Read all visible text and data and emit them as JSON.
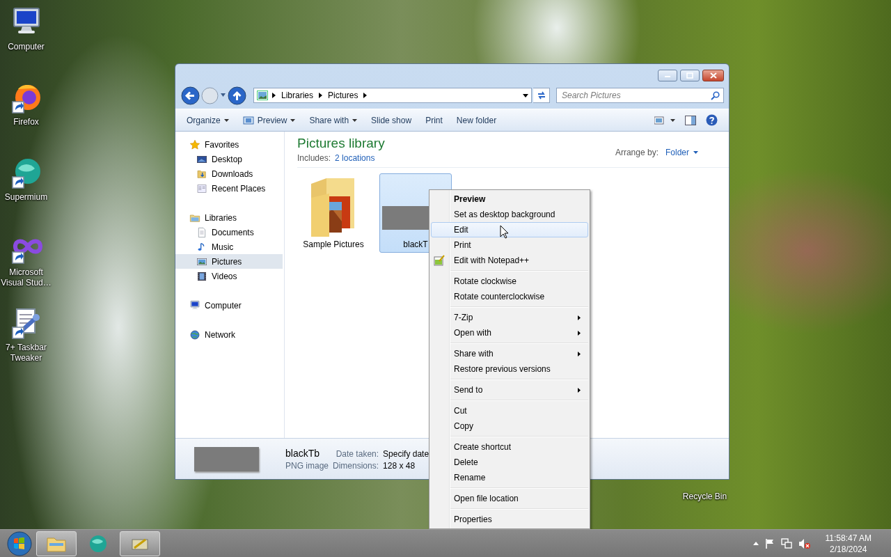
{
  "desktop_icons": [
    {
      "label": "Computer",
      "kind": "computer"
    },
    {
      "label": "Firefox",
      "kind": "firefox"
    },
    {
      "label": "Supermium",
      "kind": "supermium"
    },
    {
      "label": "Microsoft Visual Stud…",
      "kind": "infinity"
    },
    {
      "label": "7+ Taskbar Tweaker",
      "kind": "tweaker"
    }
  ],
  "recycle_bin": {
    "label": "Recycle Bin"
  },
  "window": {
    "address": {
      "path": [
        "Libraries",
        "Pictures"
      ]
    },
    "search": {
      "placeholder": "Search Pictures"
    },
    "toolbar": [
      {
        "label": "Organize",
        "kind": "menu"
      },
      {
        "label": "Preview",
        "kind": "iconmenu"
      },
      {
        "label": "Share with",
        "kind": "menu"
      },
      {
        "label": "Slide show",
        "kind": "plain"
      },
      {
        "label": "Print",
        "kind": "plain"
      },
      {
        "label": "New folder",
        "kind": "plain"
      }
    ],
    "sidebar": [
      {
        "label": "Favorites",
        "kind": "star",
        "selected": false,
        "children": [
          {
            "label": "Desktop",
            "kind": "desktop",
            "selected": false
          },
          {
            "label": "Downloads",
            "kind": "downloads",
            "selected": false
          },
          {
            "label": "Recent Places",
            "kind": "recent",
            "selected": false
          }
        ]
      },
      {
        "label": "Libraries",
        "kind": "library",
        "selected": false,
        "children": [
          {
            "label": "Documents",
            "kind": "document",
            "selected": false
          },
          {
            "label": "Music",
            "kind": "music",
            "selected": false
          },
          {
            "label": "Pictures",
            "kind": "pictures",
            "selected": true
          },
          {
            "label": "Videos",
            "kind": "video",
            "selected": false
          }
        ]
      },
      {
        "label": "Computer",
        "kind": "computer",
        "selected": false
      },
      {
        "label": "Network",
        "kind": "network",
        "selected": false
      }
    ],
    "library": {
      "title": "Pictures library",
      "includes_label": "Includes:",
      "includes_link": "2 locations",
      "arrange_label": "Arrange by:",
      "arrange_value": "Folder"
    },
    "files": [
      {
        "name": "Sample Pictures",
        "kind": "folder",
        "selected": false
      },
      {
        "name": "blackT",
        "kind": "image",
        "selected": true
      }
    ],
    "details": {
      "name": "blackTb",
      "type": "PNG image",
      "fields": [
        {
          "label": "Date taken:",
          "value": "Specify date"
        },
        {
          "label": "Dimensions:",
          "value": "128 x 48"
        }
      ]
    }
  },
  "context_menu": {
    "groups": [
      {
        "items": [
          {
            "label": "Preview",
            "default": true,
            "submenu": false,
            "selected": false,
            "icon": false
          },
          {
            "label": "Set as desktop background",
            "default": false,
            "submenu": false,
            "selected": false,
            "icon": false
          },
          {
            "label": "Edit",
            "default": false,
            "submenu": false,
            "selected": true,
            "icon": false
          },
          {
            "label": "Print",
            "default": false,
            "submenu": false,
            "selected": false,
            "icon": false
          },
          {
            "label": "Edit with Notepad++",
            "default": false,
            "submenu": false,
            "selected": false,
            "icon": true
          }
        ]
      },
      {
        "items": [
          {
            "label": "Rotate clockwise",
            "default": false,
            "submenu": false,
            "selected": false,
            "icon": false
          },
          {
            "label": "Rotate counterclockwise",
            "default": false,
            "submenu": false,
            "selected": false,
            "icon": false
          }
        ]
      },
      {
        "items": [
          {
            "label": "7-Zip",
            "default": false,
            "submenu": true,
            "selected": false,
            "icon": false
          },
          {
            "label": "Open with",
            "default": false,
            "submenu": true,
            "selected": false,
            "icon": false
          }
        ]
      },
      {
        "items": [
          {
            "label": "Share with",
            "default": false,
            "submenu": true,
            "selected": false,
            "icon": false
          },
          {
            "label": "Restore previous versions",
            "default": false,
            "submenu": false,
            "selected": false,
            "icon": false
          }
        ]
      },
      {
        "items": [
          {
            "label": "Send to",
            "default": false,
            "submenu": true,
            "selected": false,
            "icon": false
          }
        ]
      },
      {
        "items": [
          {
            "label": "Cut",
            "default": false,
            "submenu": false,
            "selected": false,
            "icon": false
          },
          {
            "label": "Copy",
            "default": false,
            "submenu": false,
            "selected": false,
            "icon": false
          }
        ]
      },
      {
        "items": [
          {
            "label": "Create shortcut",
            "default": false,
            "submenu": false,
            "selected": false,
            "icon": false
          },
          {
            "label": "Delete",
            "default": false,
            "submenu": false,
            "selected": false,
            "icon": false
          },
          {
            "label": "Rename",
            "default": false,
            "submenu": false,
            "selected": false,
            "icon": false
          }
        ]
      },
      {
        "items": [
          {
            "label": "Open file location",
            "default": false,
            "submenu": false,
            "selected": false,
            "icon": false
          }
        ]
      },
      {
        "items": [
          {
            "label": "Properties",
            "default": false,
            "submenu": false,
            "selected": false,
            "icon": false
          }
        ]
      }
    ]
  },
  "taskbar": {
    "apps": [
      {
        "kind": "explorer",
        "open": true
      },
      {
        "kind": "supermium",
        "open": false
      },
      {
        "kind": "tweaker",
        "open": true
      }
    ],
    "time": "11:58:47 AM",
    "date": "2/18/2024"
  }
}
